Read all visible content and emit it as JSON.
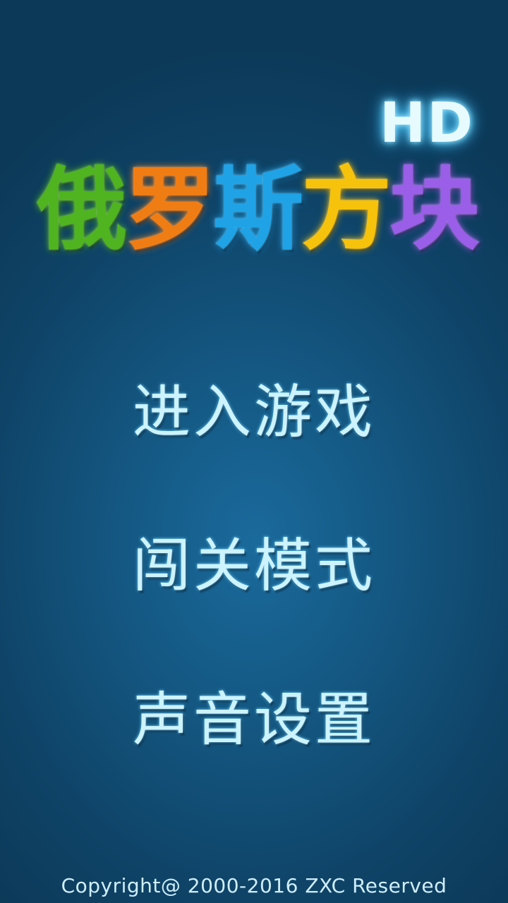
{
  "logo": {
    "badge": "HD",
    "title_chars": [
      {
        "char": "俄",
        "color": "#4fb41f"
      },
      {
        "char": "罗",
        "color": "#f07d14"
      },
      {
        "char": "斯",
        "color": "#1fa3e6"
      },
      {
        "char": "方",
        "color": "#f6c20c"
      },
      {
        "char": "块",
        "color": "#9a5ee8"
      }
    ]
  },
  "menu": {
    "items": [
      {
        "label": "进入游戏"
      },
      {
        "label": "闯关模式"
      },
      {
        "label": "声音设置"
      }
    ]
  },
  "footer": {
    "copyright": "Copyright@ 2000-2016  ZXC Reserved"
  }
}
